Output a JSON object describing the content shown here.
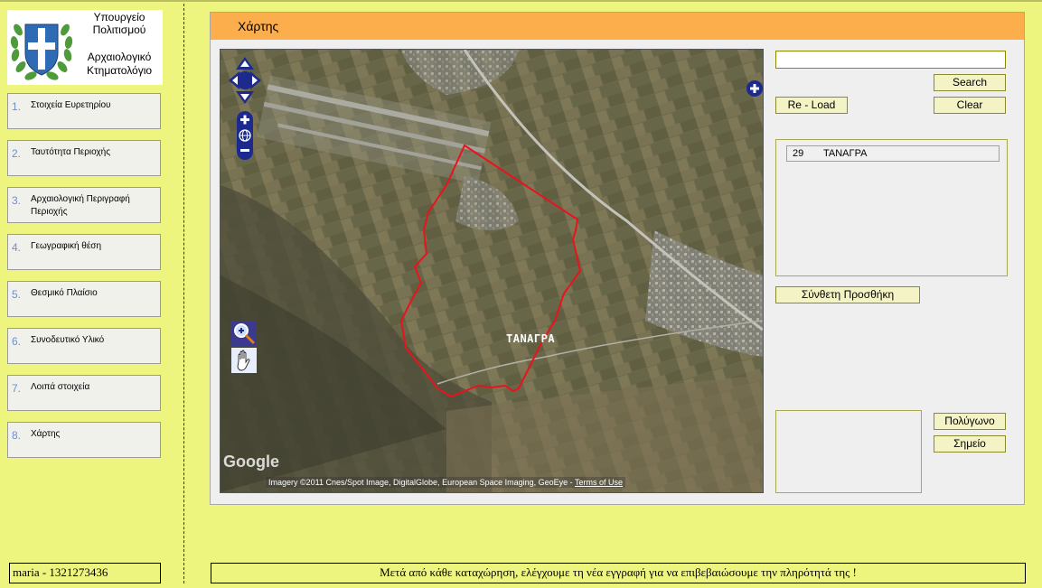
{
  "logo": {
    "line1": "Υπουργείο",
    "line2": "Πολιτισμού",
    "line3": "Αρχαιολογικό",
    "line4": "Κτηματολόγιο"
  },
  "nav": [
    {
      "num": "1.",
      "label": "Στοιχεία Ευρετηρίου"
    },
    {
      "num": "2.",
      "label": "Ταυτότητα Περιοχής"
    },
    {
      "num": "3.",
      "label": "Αρχαιολογική Περιγραφή Περιοχής"
    },
    {
      "num": "4.",
      "label": "Γεωγραφική θέση"
    },
    {
      "num": "5.",
      "label": "Θεσμικό Πλαίσιο"
    },
    {
      "num": "6.",
      "label": "Συνοδευτικό Υλικό"
    },
    {
      "num": "7.",
      "label": "Λοιπά στοιχεία"
    },
    {
      "num": "8.",
      "label": "Χάρτης"
    }
  ],
  "panel": {
    "title": "Χάρτης"
  },
  "map": {
    "place_label": "ΤΑΝΑΓΡΑ",
    "google_logo": "Google",
    "attribution": "Imagery ©2011 Cnes/Spot Image, DigitalGlobe, European Space Imaging, GeoEye - ",
    "terms_link": "Terms of Use",
    "controls": [
      "pan-arrows-icon",
      "zoom-in-icon",
      "globe-icon",
      "zoom-out-icon",
      "expand-icon",
      "zoom-box-icon",
      "hand-pan-icon"
    ]
  },
  "search": {
    "value": "",
    "search_label": "Search",
    "reload_label": "Re - Load",
    "clear_label": "Clear"
  },
  "results": [
    {
      "code": "29",
      "name": "ΤΑΝΑΓΡΑ"
    }
  ],
  "add_button": "Σύνθετη Προσθήκη",
  "geometry": {
    "polygon_label": "Πολύγωνο",
    "point_label": "Σημείο"
  },
  "footer": {
    "user": "maria - 1321273436",
    "message": "Μετά από κάθε καταχώρηση, ελέγχουμε τη νέα εγγραφή για να επιβεβαιώσουμε την πληρότητά της !"
  },
  "colors": {
    "background": "#eef57e",
    "header_orange": "#fdae4c",
    "button_bg": "#f4f3c6",
    "polygon_red": "#e8141c",
    "map_control_navy": "#1c2a8e"
  }
}
